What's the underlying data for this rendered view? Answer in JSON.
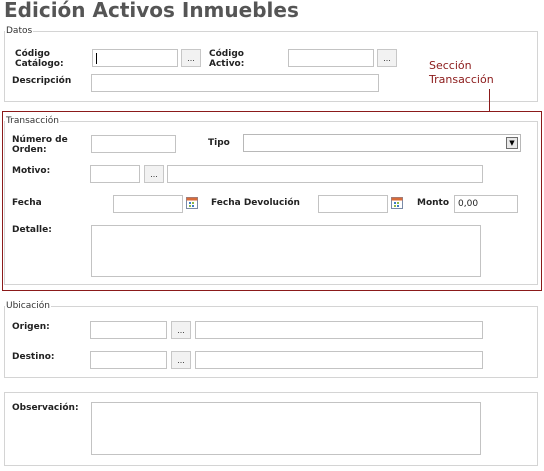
{
  "page": {
    "title": "Edición Activos Inmuebles"
  },
  "datos": {
    "legend": "Datos",
    "codigo_catalogo_label": "Código\nCatálogo:",
    "codigo_catalogo_value": "",
    "codigo_activo_label": "Código\nActivo:",
    "codigo_activo_value": "",
    "descripcion_label": "Descripción",
    "descripcion_value": "",
    "lookup_button_label": "..."
  },
  "annotation": {
    "line1": "Sección",
    "line2": "Transacción"
  },
  "transaccion": {
    "legend": "Transacción",
    "numero_orden_label": "Número de\nOrden:",
    "numero_orden_value": "",
    "tipo_label": "Tipo",
    "tipo_selected": "",
    "motivo_label": "Motivo:",
    "motivo_code": "",
    "motivo_desc": "",
    "fecha_label": "Fecha",
    "fecha_value": "",
    "fecha_devolucion_label": "Fecha Devolución",
    "fecha_devolucion_value": "",
    "monto_label": "Monto",
    "monto_value": "0,00",
    "detalle_label": "Detalle:",
    "detalle_value": "",
    "lookup_button_label": "..."
  },
  "ubicacion": {
    "legend": "Ubicación",
    "origen_label": "Origen:",
    "origen_code": "",
    "origen_desc": "",
    "destino_label": "Destino:",
    "destino_code": "",
    "destino_desc": "",
    "lookup_button_label": "..."
  },
  "observacion": {
    "label": "Observación:",
    "value": ""
  },
  "colors": {
    "annotation": "#8b1a1a",
    "border": "#d4d4d4",
    "title": "#555555"
  }
}
